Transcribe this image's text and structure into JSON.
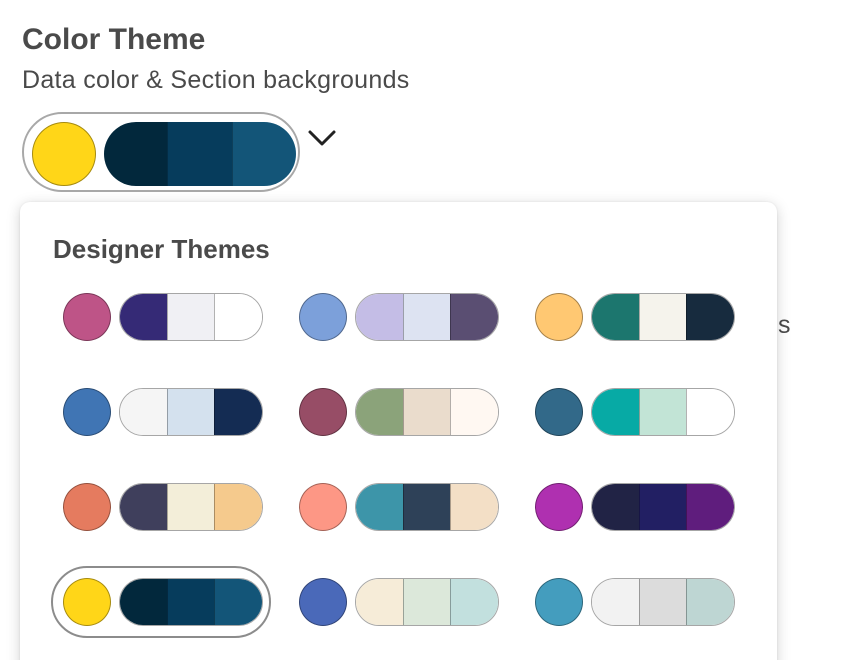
{
  "header": {
    "title": "Color Theme",
    "subtitle": "Data color & Section backgrounds"
  },
  "background_text": "s",
  "selected_theme": {
    "accent": "#ffd618",
    "swatches": [
      "#02283c",
      "#063c5c",
      "#135578"
    ]
  },
  "dropdown": {
    "title": "Designer Themes",
    "selected_index": 9,
    "themes": [
      {
        "accent": "#be5487",
        "swatches": [
          "#352a76",
          "#f0f0f4",
          "#ffffff"
        ]
      },
      {
        "accent": "#7ca0da",
        "swatches": [
          "#c4bde6",
          "#dde3f2",
          "#5a4e72"
        ]
      },
      {
        "accent": "#ffc872",
        "swatches": [
          "#1c766e",
          "#f5f3ec",
          "#172b3e"
        ]
      },
      {
        "accent": "#4075b4",
        "swatches": [
          "#f5f5f5",
          "#d4e1ee",
          "#142c53"
        ]
      },
      {
        "accent": "#974d66",
        "swatches": [
          "#8ba37a",
          "#eadccc",
          "#fff8f2"
        ]
      },
      {
        "accent": "#326989",
        "swatches": [
          "#07aaa5",
          "#c2e4d6",
          "#ffffff"
        ]
      },
      {
        "accent": "#e57b5f",
        "swatches": [
          "#3f3f5c",
          "#f3eed9",
          "#f5ca8d"
        ]
      },
      {
        "accent": "#fd9785",
        "swatches": [
          "#3d95a9",
          "#2e4158",
          "#f3dfc6"
        ]
      },
      {
        "accent": "#af30b0",
        "swatches": [
          "#212345",
          "#221f63",
          "#5f1d7d"
        ]
      },
      {
        "accent": "#ffd618",
        "swatches": [
          "#02283c",
          "#063c5c",
          "#135578"
        ]
      },
      {
        "accent": "#4a69b9",
        "swatches": [
          "#f6ecd8",
          "#dce8da",
          "#c2e0de"
        ]
      },
      {
        "accent": "#449dbe",
        "swatches": [
          "#f2f2f2",
          "#dcdcdc",
          "#bed6d3"
        ]
      }
    ]
  }
}
